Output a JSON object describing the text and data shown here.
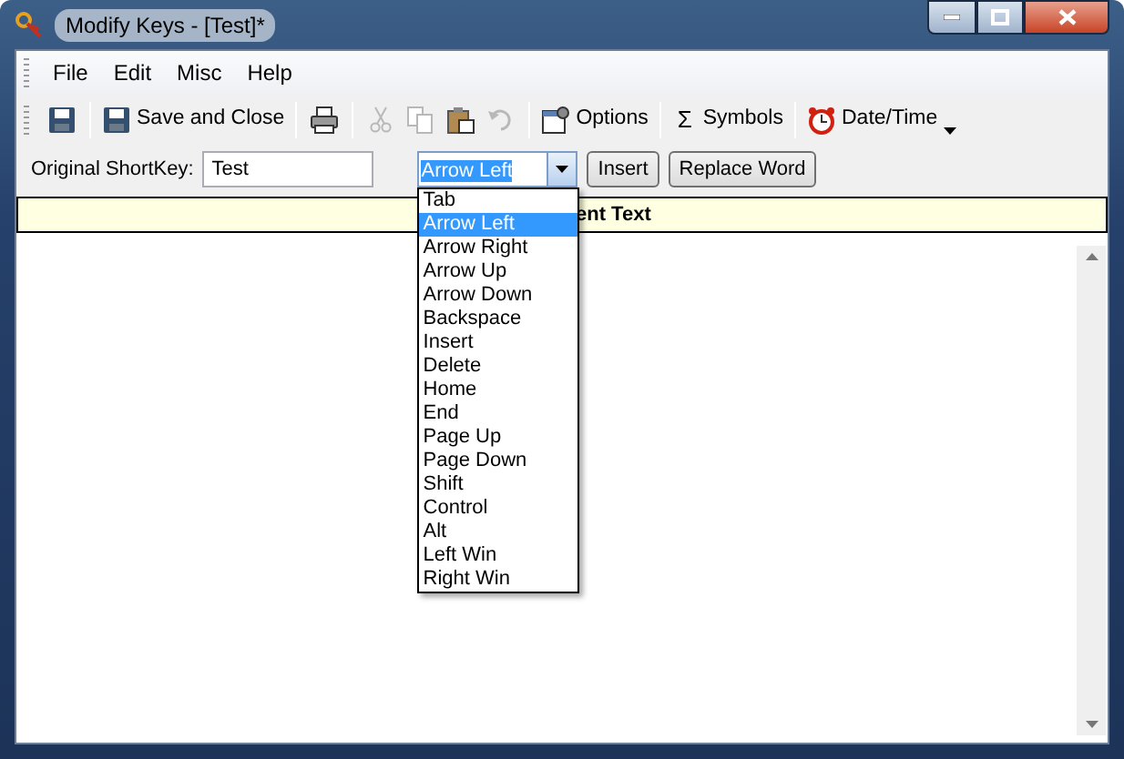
{
  "window": {
    "title": "Modify Keys - [Test]*"
  },
  "menu": [
    {
      "label": "File"
    },
    {
      "label": "Edit"
    },
    {
      "label": "Misc"
    },
    {
      "label": "Help"
    }
  ],
  "toolbar": [
    {
      "kind": "save",
      "disabled": false
    },
    {
      "kind": "separator"
    },
    {
      "kind": "saveclose",
      "label": "Save and Close"
    },
    {
      "kind": "separator"
    },
    {
      "kind": "print",
      "disabled": false
    },
    {
      "kind": "separator"
    },
    {
      "kind": "cut",
      "disabled": true
    },
    {
      "kind": "copy",
      "disabled": true
    },
    {
      "kind": "paste",
      "disabled": false
    },
    {
      "kind": "undo",
      "disabled": true
    },
    {
      "kind": "separator"
    },
    {
      "kind": "options",
      "label": "Options"
    },
    {
      "kind": "separator"
    },
    {
      "kind": "symbols",
      "glyph": "Σ",
      "label": "Symbols"
    },
    {
      "kind": "separator"
    },
    {
      "kind": "datetime",
      "label": "Date/Time",
      "dropdown": true
    }
  ],
  "shortkey": {
    "label": "Original ShortKey:",
    "value": "Test"
  },
  "key_combo": {
    "value": "Arrow Left",
    "expanded": true,
    "options": [
      {
        "label": "Tab",
        "selected": false
      },
      {
        "label": "Arrow Left",
        "selected": true
      },
      {
        "label": "Arrow Right",
        "selected": false
      },
      {
        "label": "Arrow Up",
        "selected": false
      },
      {
        "label": "Arrow Down",
        "selected": false
      },
      {
        "label": "Backspace",
        "selected": false
      },
      {
        "label": "Insert",
        "selected": false
      },
      {
        "label": "Delete",
        "selected": false
      },
      {
        "label": "Home",
        "selected": false
      },
      {
        "label": "End",
        "selected": false
      },
      {
        "label": "Page Up",
        "selected": false
      },
      {
        "label": "Page Down",
        "selected": false
      },
      {
        "label": "Shift",
        "selected": false
      },
      {
        "label": "Control",
        "selected": false
      },
      {
        "label": "Alt",
        "selected": false
      },
      {
        "label": "Left Win",
        "selected": false
      },
      {
        "label": "Right Win",
        "selected": false
      }
    ]
  },
  "buttons": [
    "Insert",
    "Replace Word"
  ],
  "replacement_header": "ent Text"
}
